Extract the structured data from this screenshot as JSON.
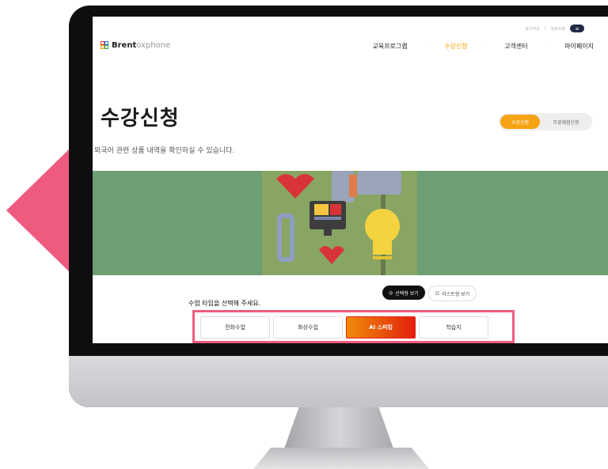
{
  "header": {
    "utility_links": [
      "로그아웃",
      "정보수정"
    ],
    "menu_icon": "hamburger-icon",
    "logo": {
      "brand_bold": "Brent",
      "brand_light": "oxphone"
    },
    "nav": [
      "교육프로그램",
      "수강신청",
      "고객센터",
      "마이페이지"
    ],
    "nav_active": "수강신청"
  },
  "page": {
    "title": "수강신청",
    "subtitle": "외국어 관련 상품 내역을 확인하실 수 있습니다.",
    "toggle": {
      "active": "수강신청",
      "inactive": "무료체험신청"
    }
  },
  "course": {
    "prompt": "수업 타입을 선택해 주세요.",
    "view_options": {
      "selected": "선택형 보기",
      "other": "리스트형 보기"
    },
    "types": [
      "전화수업",
      "화상수업",
      "AI 스피킹",
      "학습지"
    ],
    "active_type": "AI 스피킹"
  },
  "colors": {
    "accent": "#f5a300",
    "highlight": "#ef5b7f",
    "active_tab_gradient": [
      "#f08b0a",
      "#e2200c"
    ],
    "banner": "#6e9e74"
  }
}
